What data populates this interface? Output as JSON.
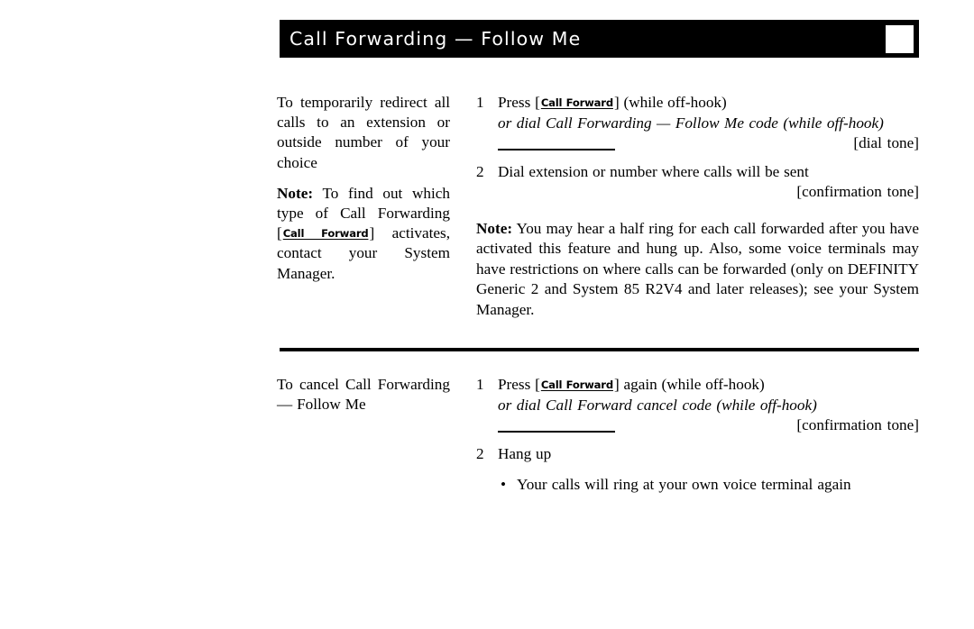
{
  "header": {
    "title": "Call Forwarding — Follow Me",
    "indicator": "white-square"
  },
  "sections": [
    {
      "id": "section-1",
      "left_column": {
        "paragraphs": [
          {
            "prefix_bold": "",
            "text": "To temporarily redirect all calls to an extension or outside number of your choice"
          }
        ],
        "note": {
          "label": "Note:",
          "text_before_key": " To find out which type of Call Forwarding ",
          "key_label": "Call Forward",
          "text_after_key": " activates, contact your System Manager."
        }
      },
      "steps": [
        {
          "number": "1",
          "text_before_key": "Press ",
          "key_label": "Call Forward",
          "text_after_key": " (while off-hook)",
          "alt_line": "or dial Call Forwarding — Follow Me code (while off-hook)",
          "has_fill_rule": true,
          "tone": "[dial tone]"
        },
        {
          "number": "2",
          "text_before_key": "Dial extension or number where calls will be sent",
          "key_label": "",
          "text_after_key": "",
          "alt_line": "",
          "has_fill_rule": false,
          "tone": "[confirmation tone]"
        }
      ],
      "note": {
        "label": "Note:",
        "text": " You may hear a half ring for each call forwarded after you have activated this feature and hung up. Also, some voice terminals may have restrictions on where calls can be forwarded (only on DEFINITY Generic 2 and System 85 R2V4 and later releases); see your System Manager."
      }
    },
    {
      "id": "section-2",
      "left_column": {
        "paragraphs": [
          {
            "prefix_bold": "",
            "text": "To cancel Call Forwarding — Follow Me"
          }
        ]
      },
      "steps": [
        {
          "number": "1",
          "text_before_key": "Press ",
          "key_label": "Call Forward",
          "text_after_key": " again (while off-hook)",
          "alt_line": "or dial Call Forward cancel code (while off-hook)",
          "has_fill_rule": true,
          "tone": "[confirmation tone]"
        },
        {
          "number": "2",
          "text_before_key": "Hang up",
          "key_label": "",
          "text_after_key": "",
          "alt_line": "",
          "has_fill_rule": false,
          "tone": ""
        }
      ],
      "bullet": {
        "marker": "•",
        "text": "Your calls will ring at your own voice terminal again"
      }
    }
  ],
  "symbols": {
    "open_bracket": "[",
    "close_bracket": "]"
  },
  "colors": {
    "page_background": "#ffffff",
    "ink": "#000000",
    "header_bar": "#000000",
    "header_text": "#ffffff"
  }
}
